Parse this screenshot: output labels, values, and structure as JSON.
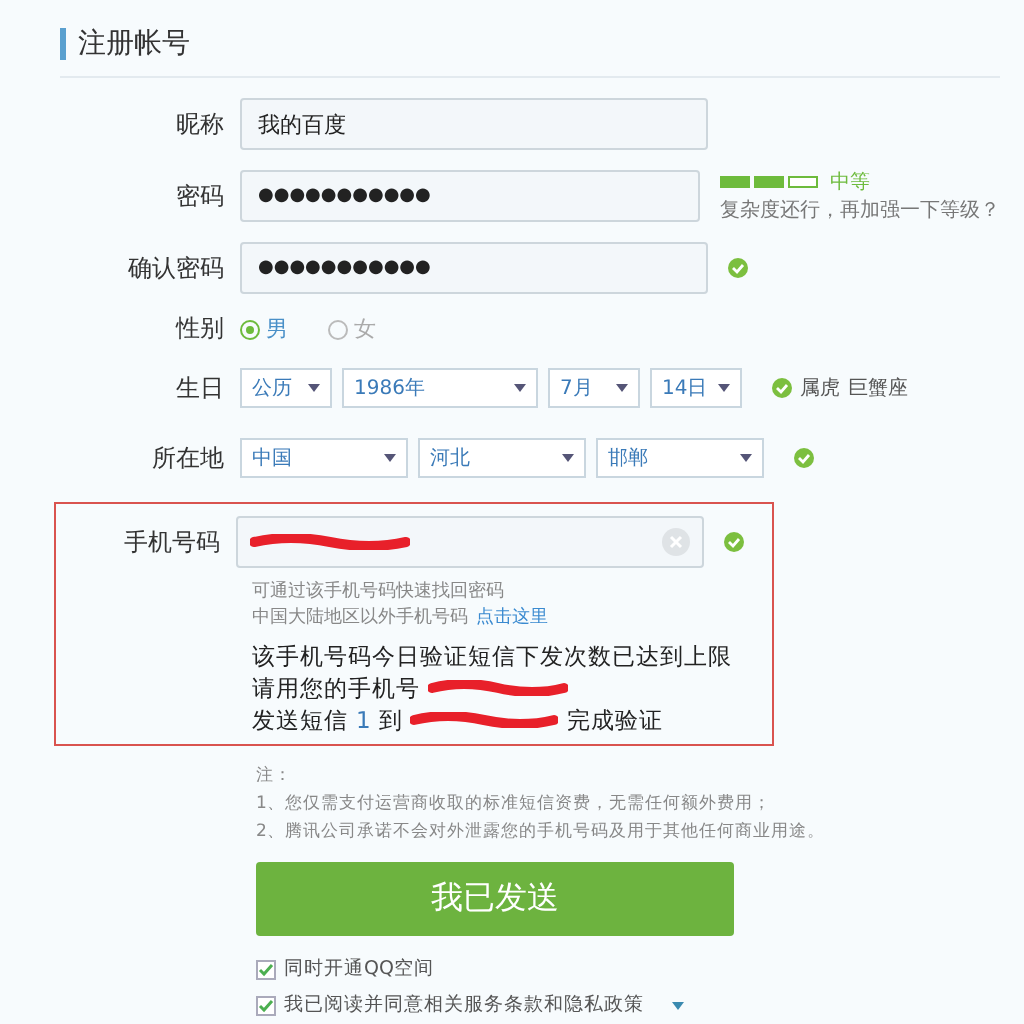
{
  "heading": "注册帐号",
  "fields": [
    {
      "kind": "text",
      "label": "昵称",
      "value": "我的百度",
      "valid": false
    },
    {
      "kind": "password",
      "label": "密码",
      "value": "●●●●●●●●●●●",
      "valid": false,
      "strength": {
        "level": 0.67,
        "label": "中等",
        "hint": "复杂度还行，再加强一下等级？"
      }
    },
    {
      "kind": "password",
      "label": "确认密码",
      "value": "●●●●●●●●●●●",
      "valid": true
    },
    {
      "kind": "radio",
      "label": "性别",
      "options": [
        {
          "label": "男",
          "selected": true
        },
        {
          "label": "女",
          "selected": false
        }
      ]
    },
    {
      "kind": "selects",
      "label": "生日",
      "selects": [
        "公历",
        "1986年",
        "7月",
        "14日"
      ],
      "valid": true,
      "notes": [
        "属虎",
        "巨蟹座"
      ]
    },
    {
      "kind": "selects",
      "label": "所在地",
      "selects": [
        "中国",
        "河北",
        "邯郸"
      ],
      "valid": true
    }
  ],
  "phone": {
    "label": "手机号码",
    "valid": true,
    "hint": "可通过该手机号码快速找回密码",
    "abroad": "中国大陆地区以外手机号码",
    "abroad_link": "点击这里",
    "limit": "该手机号码今日验证短信下发次数已达到上限",
    "use_prefix": "请用您的手机号",
    "send_prefix": "发送短信",
    "send_code": "1",
    "send_to": "到",
    "send_suffix": "完成验证"
  },
  "notes": [
    "注：",
    "1、您仅需支付运营商收取的标准短信资费，无需任何额外费用；",
    "2、腾讯公司承诺不会对外泄露您的手机号码及用于其他任何商业用途。"
  ],
  "submit": "我已发送",
  "agreements": [
    {
      "label": "同时开通QQ空间",
      "checked": true,
      "menu": false
    },
    {
      "label": "我已阅读并同意相关服务条款和隐私政策",
      "checked": true,
      "menu": true
    }
  ]
}
